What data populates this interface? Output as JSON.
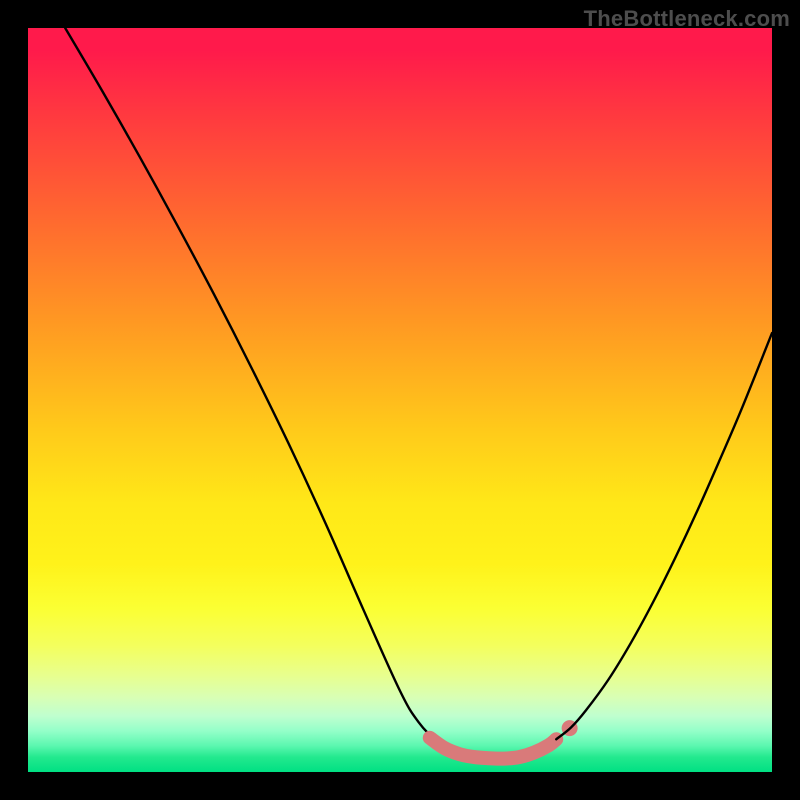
{
  "watermark": "TheBottleneck.com",
  "chart_data": {
    "type": "line",
    "title": "",
    "xlabel": "",
    "ylabel": "",
    "xlim": [
      0,
      100
    ],
    "ylim": [
      0,
      100
    ],
    "grid": false,
    "legend": false,
    "series": [
      {
        "name": "left-curve",
        "x": [
          5,
          10,
          15,
          20,
          25,
          30,
          35,
          40,
          45,
          50,
          52.5,
          55,
          57,
          58,
          59,
          60
        ],
        "y": [
          100,
          91.5,
          82.7,
          73.6,
          64.2,
          54.4,
          44.2,
          33.4,
          22.0,
          10.9,
          6.7,
          4.1,
          2.8,
          2.4,
          2.15,
          2.0
        ]
      },
      {
        "name": "dip-segment",
        "x": [
          54,
          56,
          58,
          60,
          62,
          64,
          66,
          68,
          70,
          71
        ],
        "y": [
          4.6,
          3.2,
          2.4,
          2.0,
          1.85,
          1.8,
          2.0,
          2.6,
          3.6,
          4.4
        ],
        "style": "thick-pink"
      },
      {
        "name": "dip-dot",
        "x": [
          72.8
        ],
        "y": [
          5.9
        ],
        "style": "dot-pink"
      },
      {
        "name": "right-curve",
        "x": [
          71,
          73,
          75,
          78,
          81,
          84,
          87,
          90,
          93,
          96,
          100
        ],
        "y": [
          4.4,
          6.0,
          8.3,
          12.4,
          17.3,
          22.8,
          28.8,
          35.2,
          42.0,
          49.0,
          59.0
        ]
      }
    ],
    "gradient_stops": [
      {
        "pos": 0,
        "color": "#ff1a4b"
      },
      {
        "pos": 0.26,
        "color": "#ff6a2f"
      },
      {
        "pos": 0.54,
        "color": "#ffca1a"
      },
      {
        "pos": 0.78,
        "color": "#fbff33"
      },
      {
        "pos": 0.92,
        "color": "#bfffcf"
      },
      {
        "pos": 1.0,
        "color": "#00e083"
      }
    ]
  },
  "colors": {
    "background": "#000000",
    "curve": "#000000",
    "dip": "#d97a7a",
    "watermark": "#4d4d4d"
  }
}
